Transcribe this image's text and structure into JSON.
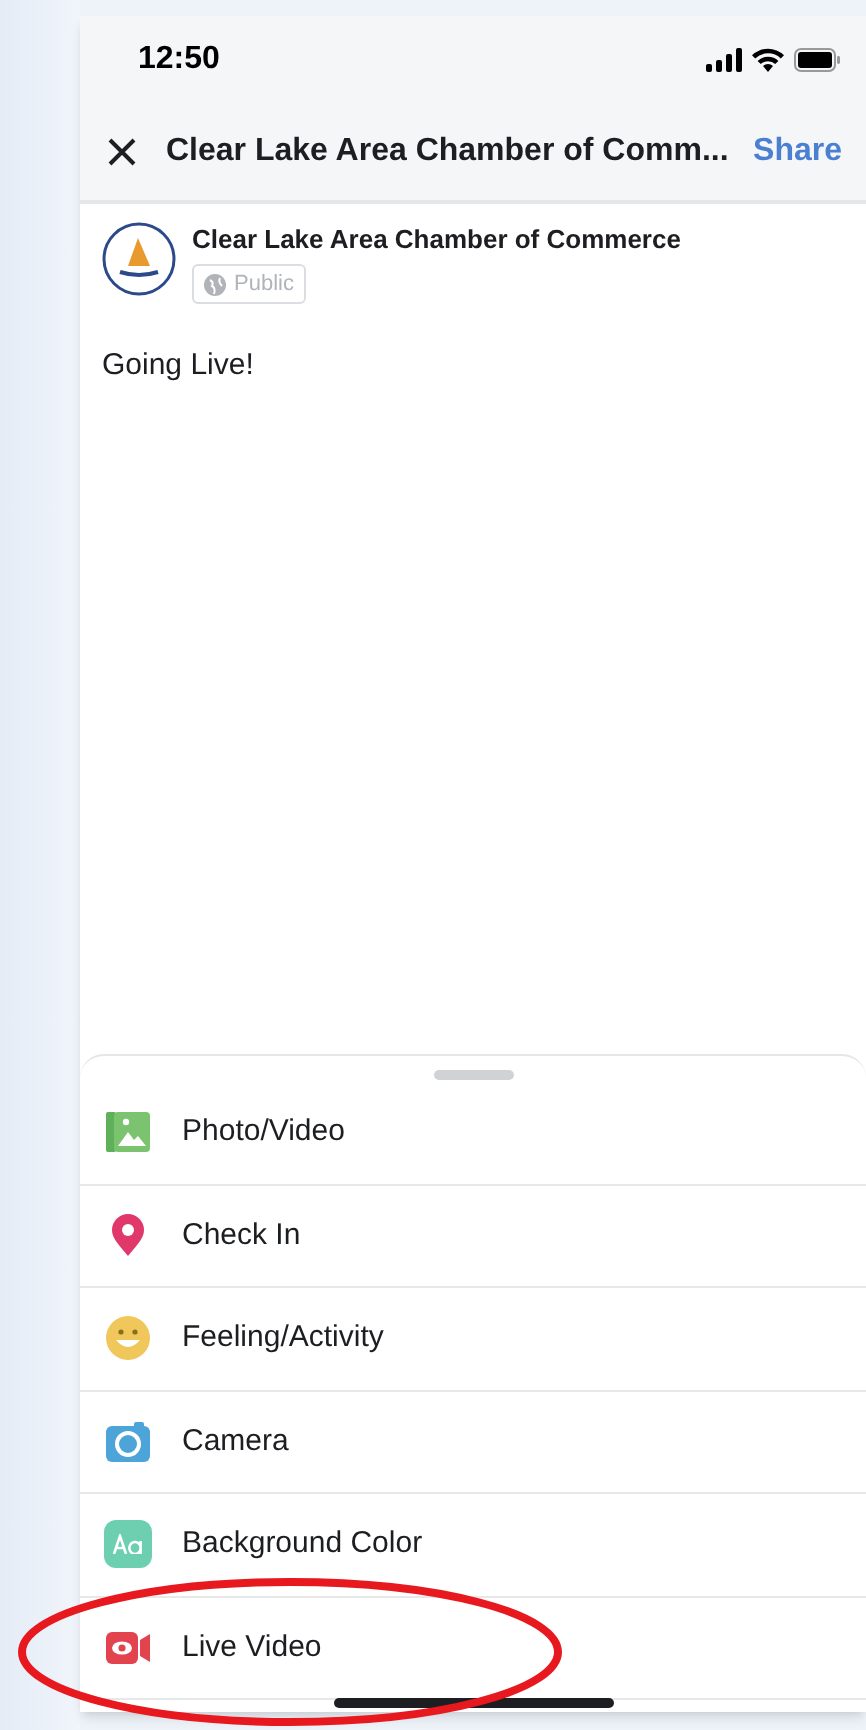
{
  "status_bar": {
    "time": "12:50"
  },
  "header": {
    "title": "Clear Lake Area Chamber of Comm...",
    "action": "Share"
  },
  "post": {
    "author": "Clear Lake Area Chamber of Commerce",
    "audience": "Public",
    "text": "Going Live!"
  },
  "options": [
    {
      "kind": "photo",
      "label": "Photo/Video",
      "highlighted": false
    },
    {
      "kind": "checkin",
      "label": "Check In",
      "highlighted": false
    },
    {
      "kind": "feeling",
      "label": "Feeling/Activity",
      "highlighted": false
    },
    {
      "kind": "camera",
      "label": "Camera",
      "highlighted": false
    },
    {
      "kind": "background",
      "label": "Background Color",
      "highlighted": false
    },
    {
      "kind": "live",
      "label": "Live Video",
      "highlighted": true
    }
  ]
}
